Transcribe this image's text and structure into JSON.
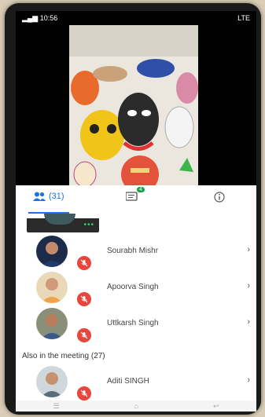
{
  "status": {
    "time": "10:56",
    "right": "LTE"
  },
  "tabs": {
    "people_count": "(31)",
    "chat_badge": "4"
  },
  "participants": [
    {
      "name": "Sourabh Mishr"
    },
    {
      "name": "Apoorva Singh"
    },
    {
      "name": "Uttkarsh Singh"
    }
  ],
  "also_section": "Also in the meeting (27)",
  "also_participants": [
    {
      "name": "Aditi SINGH"
    }
  ],
  "colors": {
    "accent": "#1a73e8",
    "mute": "#e8453c",
    "badge": "#16a34a"
  }
}
